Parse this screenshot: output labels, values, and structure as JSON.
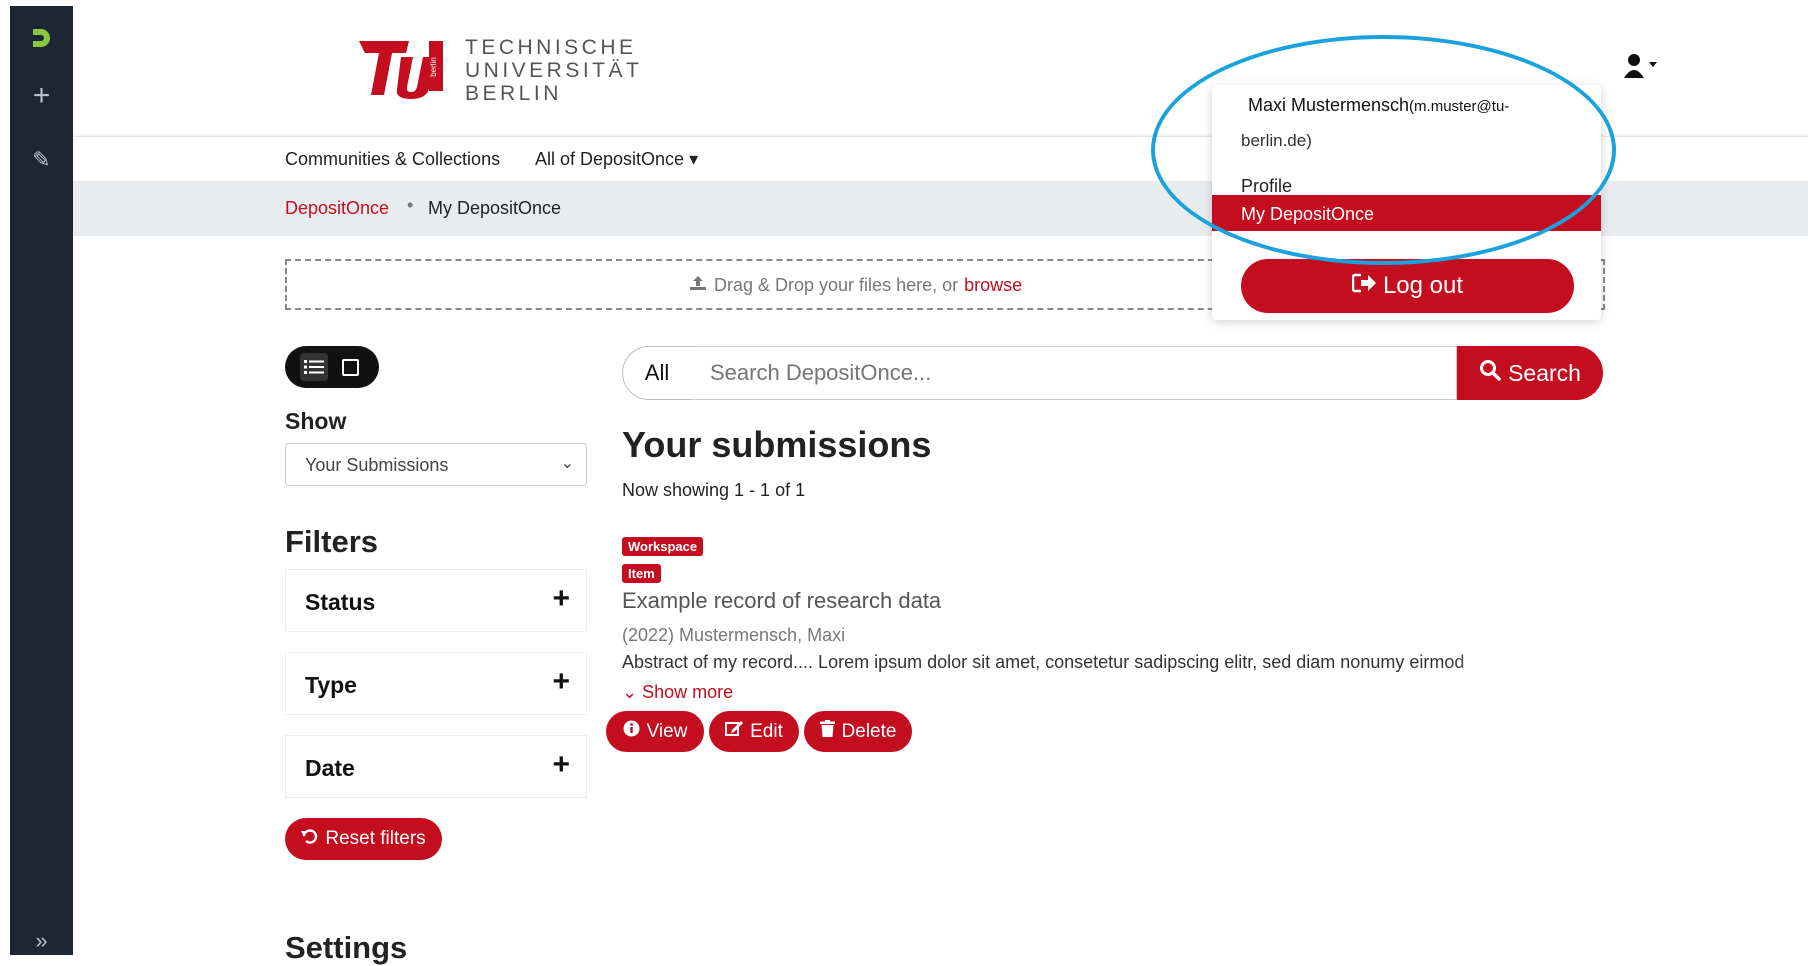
{
  "sidebar": {
    "logo_glyph": "Ŋ",
    "plus_glyph": "+",
    "edit_glyph": "✎",
    "expand_glyph": "»"
  },
  "header": {
    "logo_line1": "TECHNISCHE",
    "logo_line2": "UNIVERSITÄT",
    "logo_line3": "BERLIN",
    "logo_badge": "berlin"
  },
  "nav": {
    "communities": "Communities & Collections",
    "all_of": "All of DepositOnce ▾"
  },
  "breadcrumb": {
    "root": "DepositOnce",
    "separator": "•",
    "current": "My DepositOnce"
  },
  "dropzone": {
    "text": "Drag & Drop your files here, or",
    "link": "browse"
  },
  "sidebar_panel": {
    "show_label": "Show",
    "show_value": "Your Submissions",
    "filters_title": "Filters",
    "facets": [
      "Status",
      "Type",
      "Date"
    ],
    "facet_toggle": "+",
    "reset_label": "Reset filters",
    "settings_title": "Settings"
  },
  "search": {
    "scope": "All",
    "placeholder": "Search DepositOnce...",
    "button": "Search"
  },
  "results": {
    "title": "Your submissions",
    "now_showing": "Now showing 1 - 1 of 1",
    "badge_workspace": "Workspace",
    "badge_item": "Item",
    "item_title": "Example record of research data",
    "item_meta": "(2022) Mustermensch, Maxi",
    "item_abstract": "Abstract of my record.... Lorem ipsum dolor sit amet, consetetur sadipscing elitr, sed diam nonumy eirmod",
    "show_more": "Show more",
    "view": "View",
    "edit": "Edit",
    "delete": "Delete"
  },
  "user_menu": {
    "name": "Maxi Mustermensch",
    "email_part1": "(m.muster@tu-",
    "email_part2": "berlin.de)",
    "profile": "Profile",
    "my_depositonce": "My DepositOnce",
    "logout": "Log out"
  },
  "colors": {
    "brand": "#c40d1e",
    "sidebar": "#1c2733",
    "annotation": "#1ba1dc"
  }
}
